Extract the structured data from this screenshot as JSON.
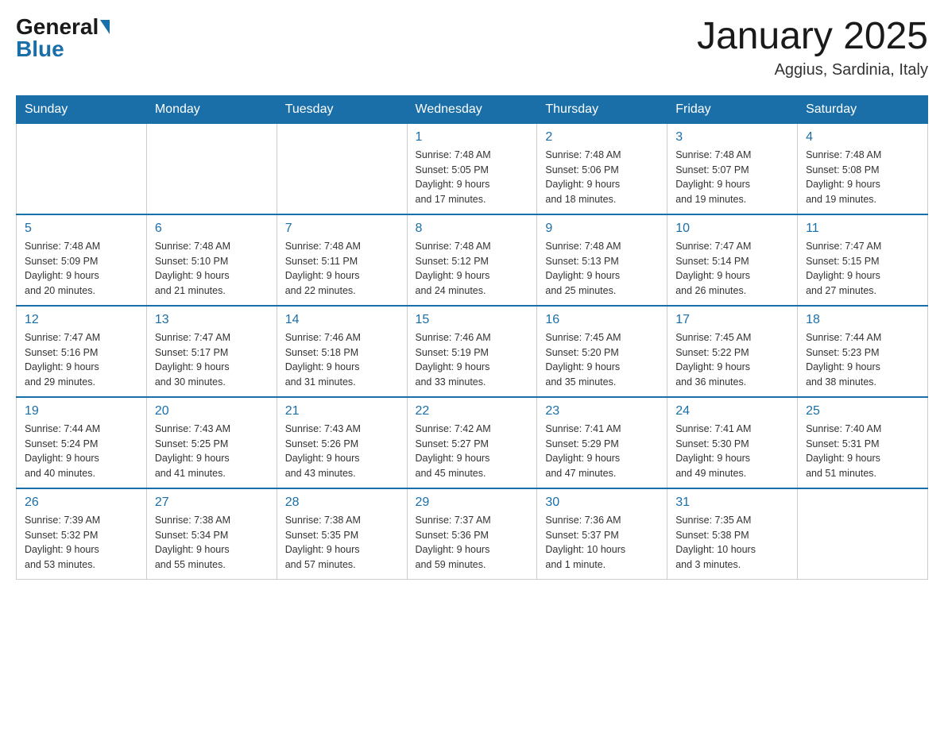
{
  "header": {
    "logo_general": "General",
    "logo_blue": "Blue",
    "month_title": "January 2025",
    "location": "Aggius, Sardinia, Italy"
  },
  "days_of_week": [
    "Sunday",
    "Monday",
    "Tuesday",
    "Wednesday",
    "Thursday",
    "Friday",
    "Saturday"
  ],
  "weeks": [
    [
      {
        "day": "",
        "info": ""
      },
      {
        "day": "",
        "info": ""
      },
      {
        "day": "",
        "info": ""
      },
      {
        "day": "1",
        "info": "Sunrise: 7:48 AM\nSunset: 5:05 PM\nDaylight: 9 hours\nand 17 minutes."
      },
      {
        "day": "2",
        "info": "Sunrise: 7:48 AM\nSunset: 5:06 PM\nDaylight: 9 hours\nand 18 minutes."
      },
      {
        "day": "3",
        "info": "Sunrise: 7:48 AM\nSunset: 5:07 PM\nDaylight: 9 hours\nand 19 minutes."
      },
      {
        "day": "4",
        "info": "Sunrise: 7:48 AM\nSunset: 5:08 PM\nDaylight: 9 hours\nand 19 minutes."
      }
    ],
    [
      {
        "day": "5",
        "info": "Sunrise: 7:48 AM\nSunset: 5:09 PM\nDaylight: 9 hours\nand 20 minutes."
      },
      {
        "day": "6",
        "info": "Sunrise: 7:48 AM\nSunset: 5:10 PM\nDaylight: 9 hours\nand 21 minutes."
      },
      {
        "day": "7",
        "info": "Sunrise: 7:48 AM\nSunset: 5:11 PM\nDaylight: 9 hours\nand 22 minutes."
      },
      {
        "day": "8",
        "info": "Sunrise: 7:48 AM\nSunset: 5:12 PM\nDaylight: 9 hours\nand 24 minutes."
      },
      {
        "day": "9",
        "info": "Sunrise: 7:48 AM\nSunset: 5:13 PM\nDaylight: 9 hours\nand 25 minutes."
      },
      {
        "day": "10",
        "info": "Sunrise: 7:47 AM\nSunset: 5:14 PM\nDaylight: 9 hours\nand 26 minutes."
      },
      {
        "day": "11",
        "info": "Sunrise: 7:47 AM\nSunset: 5:15 PM\nDaylight: 9 hours\nand 27 minutes."
      }
    ],
    [
      {
        "day": "12",
        "info": "Sunrise: 7:47 AM\nSunset: 5:16 PM\nDaylight: 9 hours\nand 29 minutes."
      },
      {
        "day": "13",
        "info": "Sunrise: 7:47 AM\nSunset: 5:17 PM\nDaylight: 9 hours\nand 30 minutes."
      },
      {
        "day": "14",
        "info": "Sunrise: 7:46 AM\nSunset: 5:18 PM\nDaylight: 9 hours\nand 31 minutes."
      },
      {
        "day": "15",
        "info": "Sunrise: 7:46 AM\nSunset: 5:19 PM\nDaylight: 9 hours\nand 33 minutes."
      },
      {
        "day": "16",
        "info": "Sunrise: 7:45 AM\nSunset: 5:20 PM\nDaylight: 9 hours\nand 35 minutes."
      },
      {
        "day": "17",
        "info": "Sunrise: 7:45 AM\nSunset: 5:22 PM\nDaylight: 9 hours\nand 36 minutes."
      },
      {
        "day": "18",
        "info": "Sunrise: 7:44 AM\nSunset: 5:23 PM\nDaylight: 9 hours\nand 38 minutes."
      }
    ],
    [
      {
        "day": "19",
        "info": "Sunrise: 7:44 AM\nSunset: 5:24 PM\nDaylight: 9 hours\nand 40 minutes."
      },
      {
        "day": "20",
        "info": "Sunrise: 7:43 AM\nSunset: 5:25 PM\nDaylight: 9 hours\nand 41 minutes."
      },
      {
        "day": "21",
        "info": "Sunrise: 7:43 AM\nSunset: 5:26 PM\nDaylight: 9 hours\nand 43 minutes."
      },
      {
        "day": "22",
        "info": "Sunrise: 7:42 AM\nSunset: 5:27 PM\nDaylight: 9 hours\nand 45 minutes."
      },
      {
        "day": "23",
        "info": "Sunrise: 7:41 AM\nSunset: 5:29 PM\nDaylight: 9 hours\nand 47 minutes."
      },
      {
        "day": "24",
        "info": "Sunrise: 7:41 AM\nSunset: 5:30 PM\nDaylight: 9 hours\nand 49 minutes."
      },
      {
        "day": "25",
        "info": "Sunrise: 7:40 AM\nSunset: 5:31 PM\nDaylight: 9 hours\nand 51 minutes."
      }
    ],
    [
      {
        "day": "26",
        "info": "Sunrise: 7:39 AM\nSunset: 5:32 PM\nDaylight: 9 hours\nand 53 minutes."
      },
      {
        "day": "27",
        "info": "Sunrise: 7:38 AM\nSunset: 5:34 PM\nDaylight: 9 hours\nand 55 minutes."
      },
      {
        "day": "28",
        "info": "Sunrise: 7:38 AM\nSunset: 5:35 PM\nDaylight: 9 hours\nand 57 minutes."
      },
      {
        "day": "29",
        "info": "Sunrise: 7:37 AM\nSunset: 5:36 PM\nDaylight: 9 hours\nand 59 minutes."
      },
      {
        "day": "30",
        "info": "Sunrise: 7:36 AM\nSunset: 5:37 PM\nDaylight: 10 hours\nand 1 minute."
      },
      {
        "day": "31",
        "info": "Sunrise: 7:35 AM\nSunset: 5:38 PM\nDaylight: 10 hours\nand 3 minutes."
      },
      {
        "day": "",
        "info": ""
      }
    ]
  ]
}
